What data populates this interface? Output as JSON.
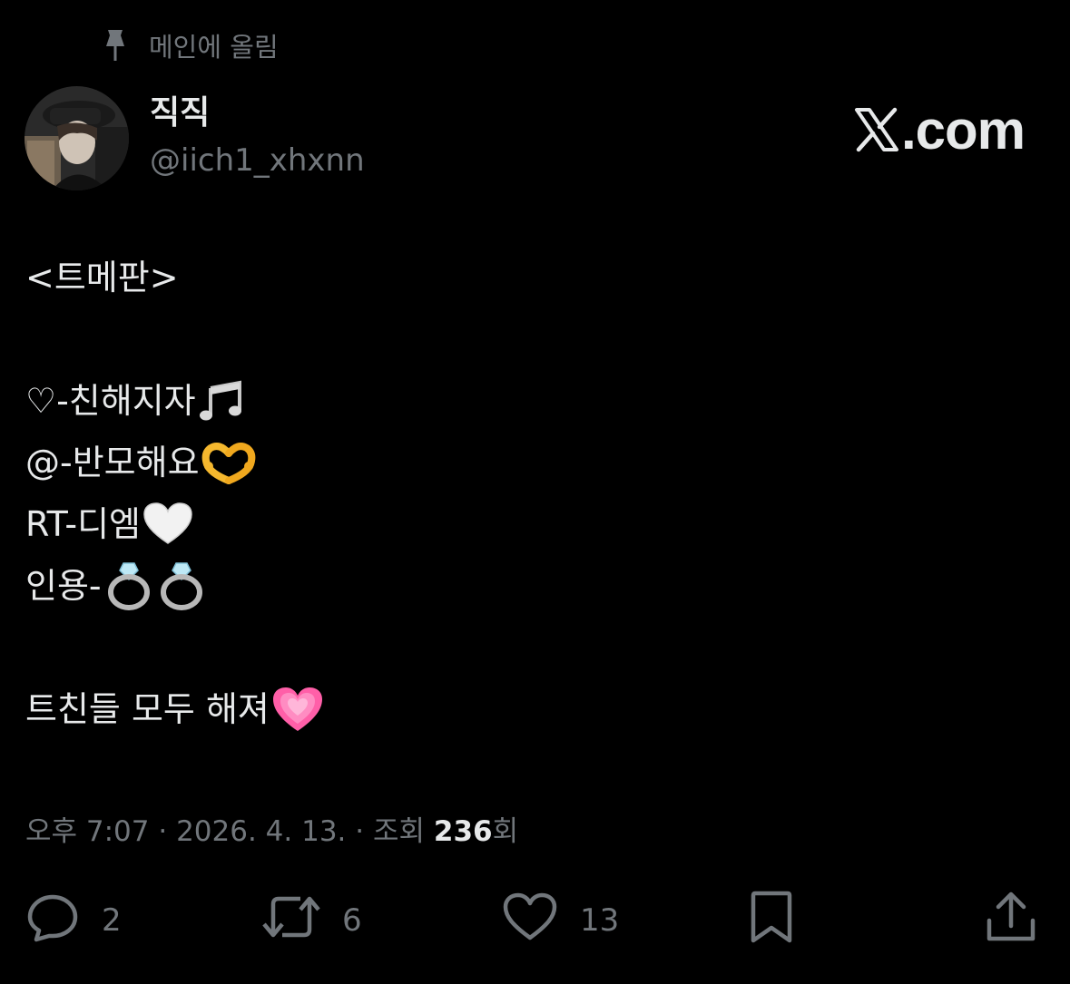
{
  "pinned": {
    "icon": "pin-icon",
    "label": "메인에 올림"
  },
  "author": {
    "display_name": "직직",
    "handle": "@iich1_xhxnn",
    "avatar": "avatar"
  },
  "watermark": {
    "text": ".com"
  },
  "tweet": {
    "lines": [
      {
        "text": "<트메판>",
        "emoji": ""
      },
      {
        "text": "",
        "emoji": ""
      },
      {
        "text": "♡-친해지자",
        "emoji": "music-notes"
      },
      {
        "text": "@-반모해요",
        "emoji": "heart-hands"
      },
      {
        "text": "RT-디엠",
        "emoji": "white-heart"
      },
      {
        "text": "인용-",
        "emoji": "two-rings"
      },
      {
        "text": "",
        "emoji": ""
      },
      {
        "text": "트친들 모두 해져",
        "emoji": "growing-heart"
      }
    ]
  },
  "meta": {
    "time": "오후 7:07",
    "separator": " · ",
    "date": "2026. 4. 13.",
    "views_label": "조회",
    "views_count": "236",
    "views_suffix": "회"
  },
  "actions": {
    "replies": {
      "icon": "reply-icon",
      "count": "2"
    },
    "retweets": {
      "icon": "retweet-icon",
      "count": "6"
    },
    "likes": {
      "icon": "heart-icon",
      "count": "13"
    },
    "bookmark": {
      "icon": "bookmark-icon"
    },
    "share": {
      "icon": "share-icon"
    }
  },
  "colors": {
    "background": "#000000",
    "primary_text": "#e7e9ea",
    "secondary_text": "#71767b",
    "pink_heart": "#ff5fa8",
    "gold": "#f5b82e"
  }
}
